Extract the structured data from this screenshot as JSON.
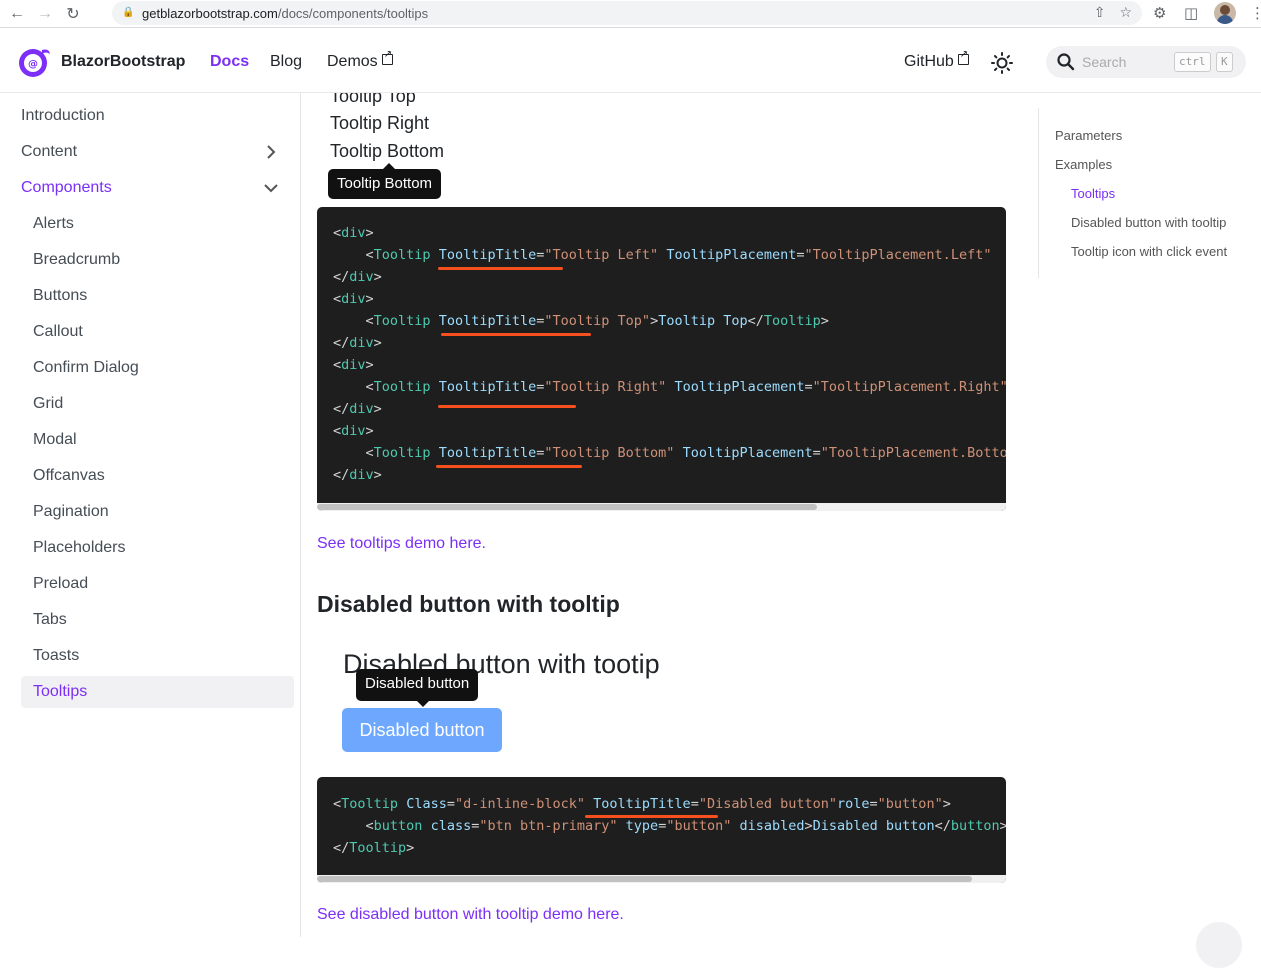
{
  "browser": {
    "url_host": "getblazorbootstrap.com",
    "url_path": "/docs/components/tooltips"
  },
  "header": {
    "brand": "BlazorBootstrap",
    "nav": [
      "Docs",
      "Blog",
      "Demos"
    ],
    "github": "GitHub",
    "search_placeholder": "Search",
    "kbd_ctrl": "ctrl",
    "kbd_k": "K"
  },
  "sidebar": {
    "items": [
      {
        "label": "Introduction"
      },
      {
        "label": "Content"
      },
      {
        "label": "Components"
      },
      {
        "label": "Alerts"
      },
      {
        "label": "Breadcrumb"
      },
      {
        "label": "Buttons"
      },
      {
        "label": "Callout"
      },
      {
        "label": "Confirm Dialog"
      },
      {
        "label": "Grid"
      },
      {
        "label": "Modal"
      },
      {
        "label": "Offcanvas"
      },
      {
        "label": "Pagination"
      },
      {
        "label": "Placeholders"
      },
      {
        "label": "Preload"
      },
      {
        "label": "Tabs"
      },
      {
        "label": "Toasts"
      },
      {
        "label": "Tooltips"
      }
    ]
  },
  "main": {
    "demo_links": [
      "Tooltip Top",
      "Tooltip Right",
      "Tooltip Bottom"
    ],
    "tooltip_bottom": "Tooltip Bottom",
    "see_tooltips": "See tooltips demo here.",
    "section_heading": "Disabled button with tooltip",
    "demo_heading": "Disabled button with tootip",
    "disabled_tooltip": "Disabled button",
    "disabled_button": "Disabled button",
    "see_disabled": "See disabled button with tooltip demo here."
  },
  "toc": {
    "items": [
      "Parameters",
      "Examples",
      "Tooltips",
      "Disabled button with tooltip",
      "Tooltip icon with click event"
    ]
  },
  "colors": {
    "accent": "#7b2ff7",
    "code_bg": "#1e1e1e",
    "annotation": "#f5501e",
    "disabled_button": "#6ea8fe"
  }
}
